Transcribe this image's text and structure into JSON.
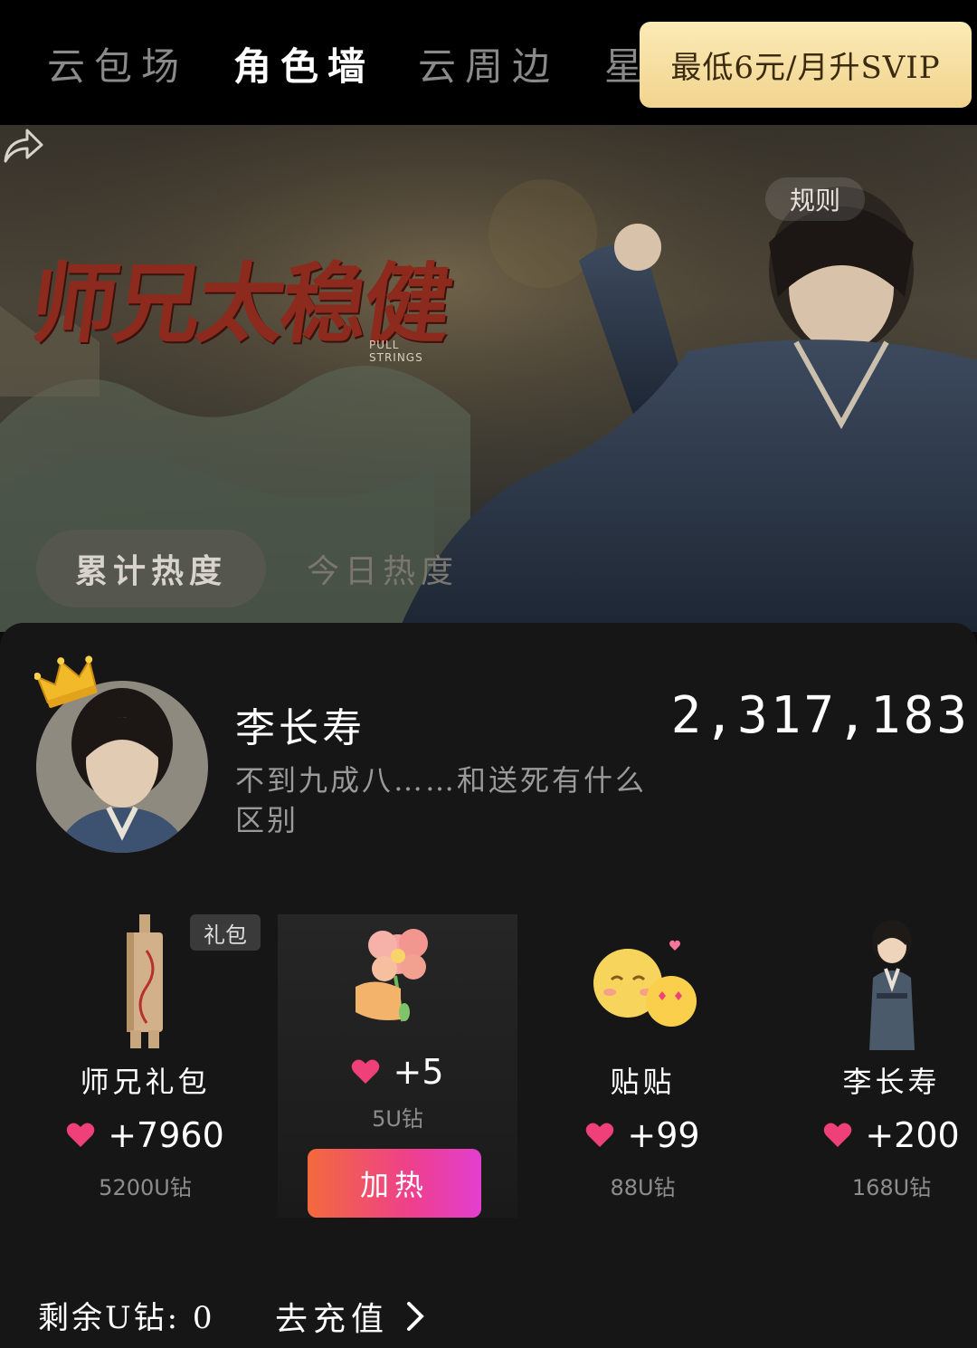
{
  "top_tabs": [
    "云包场",
    "角色墙",
    "云周边",
    "星"
  ],
  "vip_button": "最低6元/月升SVIP",
  "banner": {
    "title_art": "师兄太稳健",
    "subtitle_art": "PULL STRINGS",
    "rules": "规则",
    "share_icon": "share-icon"
  },
  "heat_tabs": {
    "cumulative": "累计热度",
    "today": "今日热度"
  },
  "character": {
    "name": "李长寿",
    "quote": "不到九成八……和送死有什么区别",
    "heat": "2,317,183"
  },
  "gifts": [
    {
      "name": "师兄礼包",
      "tag": "礼包",
      "points": "+7960",
      "cost": "5200U钻",
      "icon": "gift-pack-icon"
    },
    {
      "name": "",
      "points": "+5",
      "cost": "5U钻",
      "icon": "flower-bouquet-icon",
      "button": "加热"
    },
    {
      "name": "贴贴",
      "points": "+99",
      "cost": "88U钻",
      "icon": "cuddle-emoji-icon"
    },
    {
      "name": "李长寿",
      "points": "+200",
      "cost": "168U钻",
      "icon": "character-figure-icon"
    }
  ],
  "footer": {
    "balance": "剩余U钻: 0",
    "recharge": "去充值"
  },
  "colors": {
    "vip_gold": "#f5dc9a",
    "heart": "#f0407a",
    "boost_start": "#f26a3b",
    "boost_end": "#e23fd0"
  }
}
